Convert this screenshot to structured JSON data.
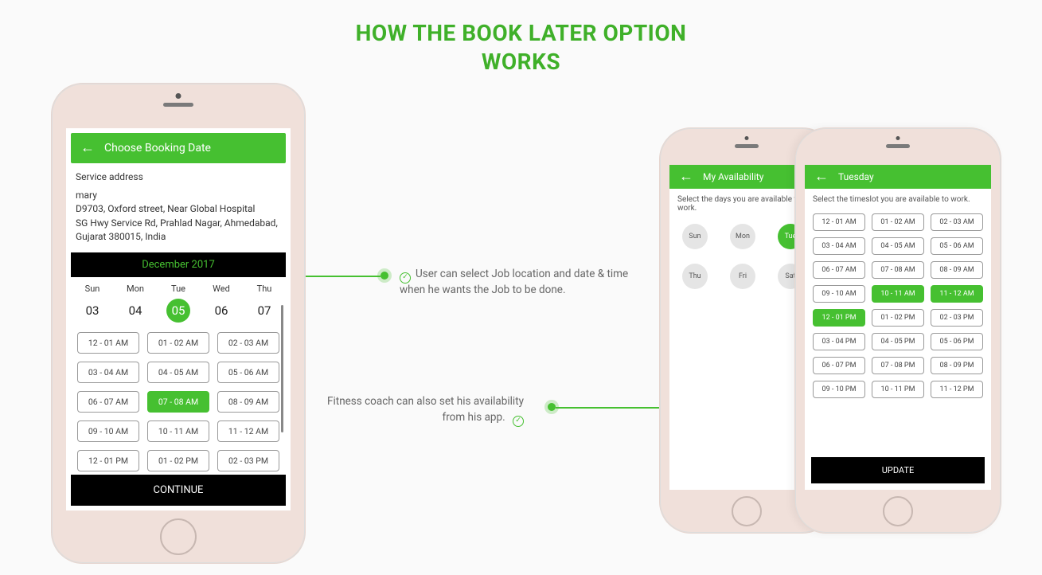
{
  "title_line1": "HOW THE BOOK LATER OPTION",
  "title_line2": "WORKS",
  "caption1": "User can select Job location and date & time when he wants the Job to be done.",
  "caption2": "Fitness coach can also set his availability from his app.",
  "phone1": {
    "header": "Choose Booking Date",
    "service_label": "Service address",
    "addr_name": "mary",
    "addr_l1": "D9703, Oxford street, Near Global Hospital",
    "addr_l2": "SG Hwy Service Rd, Prahlad Nagar, Ahmedabad,",
    "addr_l3": "Gujarat 380015, India",
    "month": "December 2017",
    "days": [
      {
        "name": "Sun",
        "num": "03",
        "sel": false
      },
      {
        "name": "Mon",
        "num": "04",
        "sel": false
      },
      {
        "name": "Tue",
        "num": "05",
        "sel": true
      },
      {
        "name": "Wed",
        "num": "06",
        "sel": false
      },
      {
        "name": "Thu",
        "num": "07",
        "sel": false
      }
    ],
    "slots": [
      [
        "12 - 01 AM",
        "01 - 02 AM",
        "02 - 03 AM"
      ],
      [
        "03 - 04 AM",
        "04 - 05 AM",
        "05 - 06 AM"
      ],
      [
        "06 - 07 AM",
        "07 - 08 AM",
        "08 - 09 AM"
      ],
      [
        "09 - 10 AM",
        "10 - 11 AM",
        "11 - 12 AM"
      ],
      [
        "12 - 01 PM",
        "01 - 02 PM",
        "02 - 03 PM"
      ]
    ],
    "slot_selected": "07 - 08 AM",
    "cta": "CONTINUE"
  },
  "phone2": {
    "header": "My Availability",
    "sub": "Select the days you are available to work.",
    "days": [
      {
        "label": "Sun",
        "sel": false
      },
      {
        "label": "Mon",
        "sel": false
      },
      {
        "label": "Tue",
        "sel": true
      },
      {
        "label": "Thu",
        "sel": false
      },
      {
        "label": "Fri",
        "sel": false
      },
      {
        "label": "Sat",
        "sel": false
      }
    ]
  },
  "phone3": {
    "header": "Tuesday",
    "sub": "Select the timeslot you are available to work.",
    "slots": [
      {
        "t": "12 - 01 AM",
        "sel": false
      },
      {
        "t": "01 - 02 AM",
        "sel": false
      },
      {
        "t": "02 - 03 AM",
        "sel": false
      },
      {
        "t": "03 - 04 AM",
        "sel": false
      },
      {
        "t": "04 - 05 AM",
        "sel": false
      },
      {
        "t": "05 - 06 AM",
        "sel": false
      },
      {
        "t": "06 - 07 AM",
        "sel": false
      },
      {
        "t": "07 - 08 AM",
        "sel": false
      },
      {
        "t": "08 - 09 AM",
        "sel": false
      },
      {
        "t": "09 - 10 AM",
        "sel": false
      },
      {
        "t": "10 - 11 AM",
        "sel": true
      },
      {
        "t": "11 - 12 AM",
        "sel": true
      },
      {
        "t": "12 - 01 PM",
        "sel": true
      },
      {
        "t": "01 - 02 PM",
        "sel": false
      },
      {
        "t": "02 - 03 PM",
        "sel": false
      },
      {
        "t": "03 - 04 PM",
        "sel": false
      },
      {
        "t": "04 - 05 PM",
        "sel": false
      },
      {
        "t": "05 - 06 PM",
        "sel": false
      },
      {
        "t": "06 - 07 PM",
        "sel": false
      },
      {
        "t": "07 - 08 PM",
        "sel": false
      },
      {
        "t": "08 - 09 PM",
        "sel": false
      },
      {
        "t": "09 - 10 PM",
        "sel": false
      },
      {
        "t": "10 - 11 PM",
        "sel": false
      },
      {
        "t": "11 - 12 PM",
        "sel": false
      }
    ],
    "cta": "UPDATE"
  }
}
